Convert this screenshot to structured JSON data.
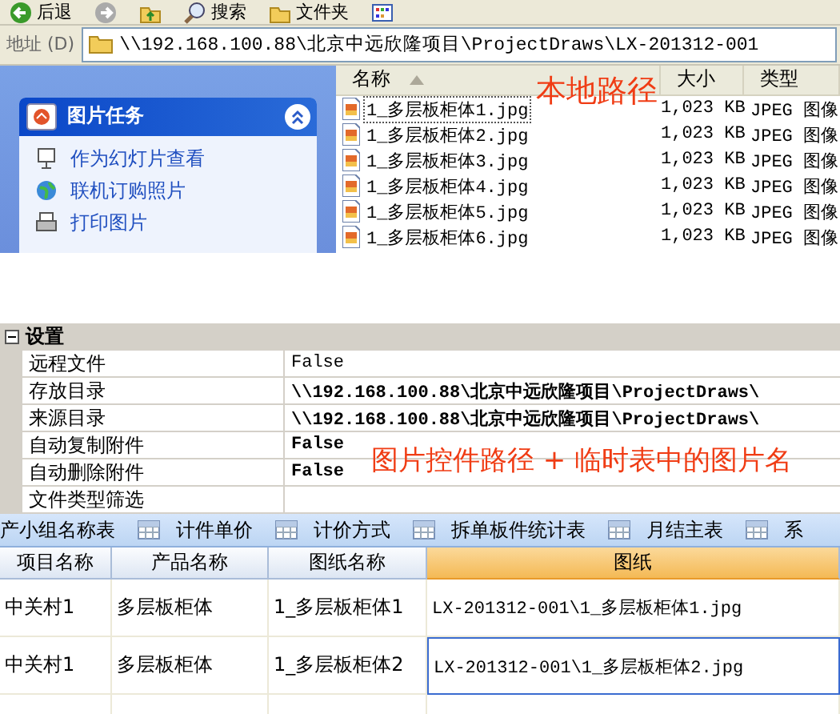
{
  "toolbar": {
    "buttons": [
      {
        "kind": "back",
        "label": "后退"
      },
      {
        "kind": "forward"
      },
      {
        "kind": "up"
      },
      {
        "kind": "search",
        "label": "搜索"
      },
      {
        "kind": "folders",
        "label": "文件夹"
      },
      {
        "kind": "views"
      }
    ]
  },
  "address_bar": {
    "label": "地址 (D)",
    "value": "\\\\192.168.100.88\\北京中远欣隆项目\\ProjectDraws\\LX-201312-001"
  },
  "explorer": {
    "task_panel": {
      "title": "图片任务",
      "expanded": true,
      "items": [
        {
          "kind": "slideshow",
          "label": "作为幻灯片查看"
        },
        {
          "kind": "order",
          "label": "联机订购照片"
        },
        {
          "kind": "print",
          "label": "打印图片"
        }
      ]
    },
    "columns": [
      {
        "label": "名称",
        "sorted": true
      },
      {
        "label": "大小",
        "sorted": false
      },
      {
        "label": "类型",
        "sorted": false
      }
    ],
    "annotation": "本地路径",
    "files": [
      {
        "name": "1_多层板柜体1.jpg",
        "size": "1,023 KB",
        "type": "JPEG 图像",
        "focused": true
      },
      {
        "name": "1_多层板柜体2.jpg",
        "size": "1,023 KB",
        "type": "JPEG 图像",
        "focused": false
      },
      {
        "name": "1_多层板柜体3.jpg",
        "size": "1,023 KB",
        "type": "JPEG 图像",
        "focused": false
      },
      {
        "name": "1_多层板柜体4.jpg",
        "size": "1,023 KB",
        "type": "JPEG 图像",
        "focused": false
      },
      {
        "name": "1_多层板柜体5.jpg",
        "size": "1,023 KB",
        "type": "JPEG 图像",
        "focused": false
      },
      {
        "name": "1_多层板柜体6.jpg",
        "size": "1,023 KB",
        "type": "JPEG 图像",
        "focused": false
      }
    ]
  },
  "property_grid": {
    "category": "设置",
    "expanded": true,
    "annotation": "图片控件路径 + 临时表中的图片名",
    "rows": [
      {
        "name": "远程文件",
        "value": "False",
        "modified": false
      },
      {
        "name": "存放目录",
        "value": "\\\\192.168.100.88\\北京中远欣隆项目\\ProjectDraws\\",
        "modified": true
      },
      {
        "name": "来源目录",
        "value": "\\\\192.168.100.88\\北京中远欣隆项目\\ProjectDraws\\",
        "modified": true
      },
      {
        "name": "自动复制附件",
        "value": "False",
        "modified": true
      },
      {
        "name": "自动删除附件",
        "value": "False",
        "modified": true
      },
      {
        "name": "文件类型筛选"
      }
    ]
  },
  "tabs": [
    {
      "label": "产小组名称表"
    },
    {
      "label": "计件单价"
    },
    {
      "label": "计价方式"
    },
    {
      "label": "拆单板件统计表"
    },
    {
      "label": "月结主表"
    },
    {
      "label": "系"
    }
  ],
  "grid": {
    "columns": [
      {
        "label": "项目名称",
        "selected": false
      },
      {
        "label": "产品名称",
        "selected": false
      },
      {
        "label": "图纸名称",
        "selected": false
      },
      {
        "label": "图纸",
        "selected": true
      }
    ],
    "rows": [
      {
        "cells": [
          "中关村1",
          "多层板柜体",
          "1_多层板柜体1",
          "LX-201312-001\\1_多层板柜体1.jpg"
        ],
        "selected": false
      },
      {
        "cells": [
          "中关村1",
          "多层板柜体",
          "1_多层板柜体2",
          "LX-201312-001\\1_多层板柜体2.jpg"
        ],
        "selected": true
      }
    ]
  }
}
